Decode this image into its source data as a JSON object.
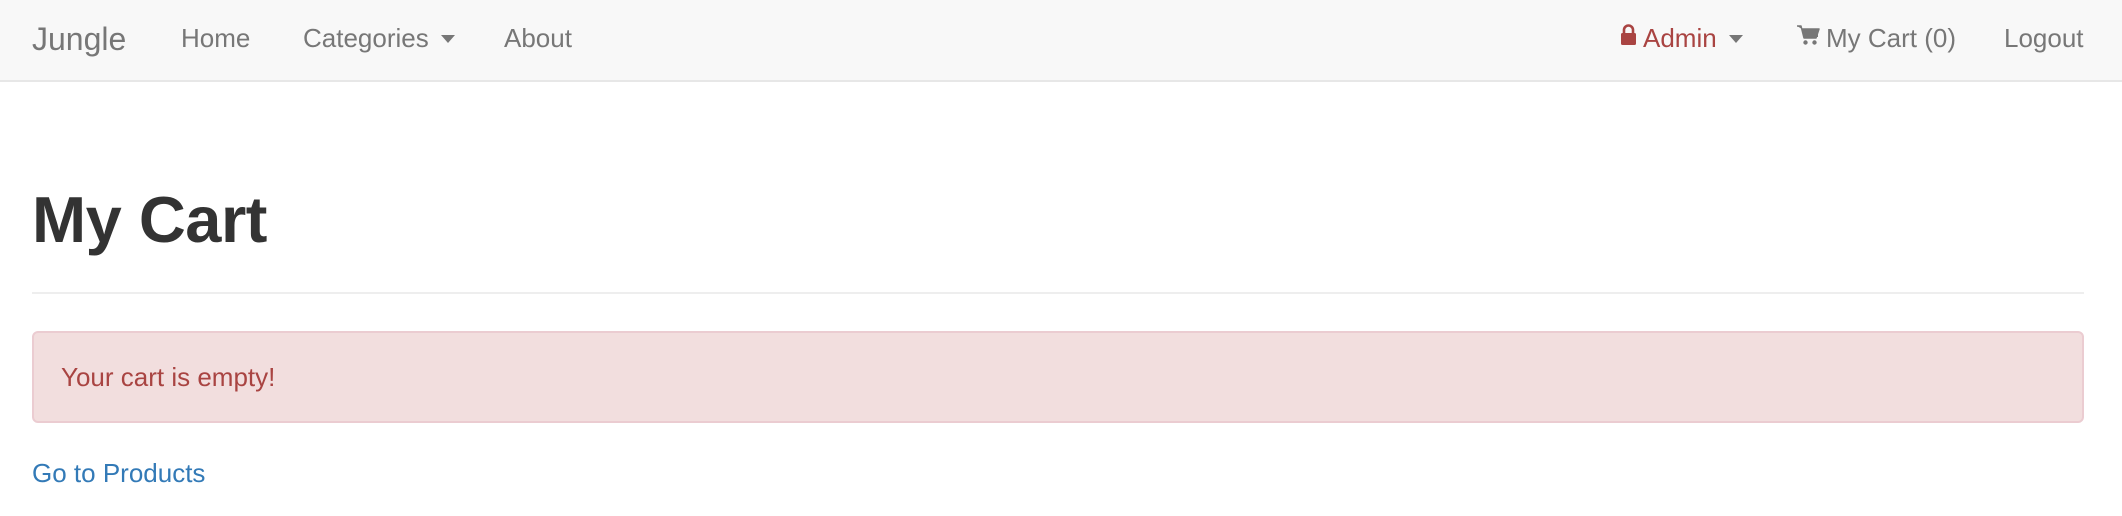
{
  "navbar": {
    "brand": "Jungle",
    "items": [
      {
        "label": "Home"
      },
      {
        "label": "Categories"
      },
      {
        "label": "About"
      }
    ],
    "right": {
      "admin_label": "Admin",
      "cart_label": "My Cart (0)",
      "logout_label": "Logout"
    }
  },
  "page": {
    "title": "My Cart",
    "alert_text": "Your cart is empty!",
    "link_text": "Go to Products"
  },
  "colors": {
    "navbar_bg": "#f8f8f8",
    "nav_text": "#777777",
    "admin_red": "#a94442",
    "alert_bg": "#f2dede",
    "alert_border": "#ebccd1",
    "link_blue": "#337ab7"
  },
  "icons": {
    "admin": "lock-icon",
    "cart": "shopping-cart-icon",
    "dropdown": "caret-down-icon"
  }
}
